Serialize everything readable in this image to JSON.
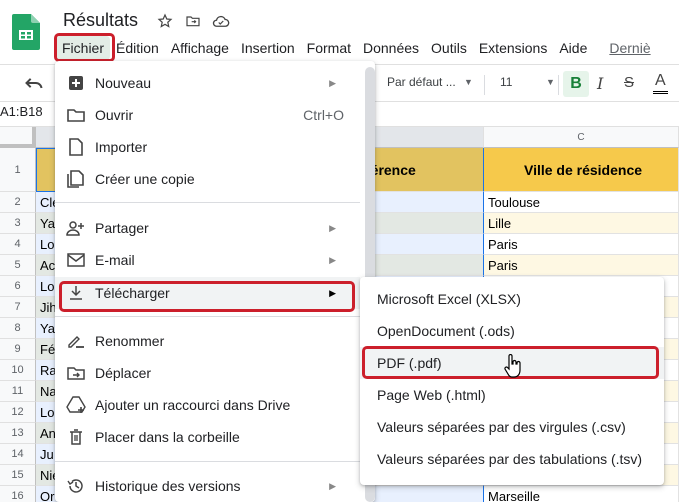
{
  "app": {
    "title": "Résultats",
    "logo_icon": "google-sheets-logo",
    "title_icons": [
      "star-icon",
      "move-to-folder-icon",
      "cloud-saved-icon"
    ]
  },
  "menubar": {
    "items": [
      "Fichier",
      "Édition",
      "Affichage",
      "Insertion",
      "Format",
      "Données",
      "Outils",
      "Extensions",
      "Aide"
    ],
    "active": "Fichier",
    "last_edit": "Derniè"
  },
  "toolbar": {
    "undo_icon": "undo-icon",
    "font": "Par défaut ...",
    "font_size": "11",
    "bold": "B",
    "italic": "I",
    "strike": "S",
    "text_color": "A"
  },
  "name_box": "A1:B18",
  "grid": {
    "columns": [
      {
        "letter": "",
        "selected": true
      },
      {
        "letter": "",
        "selected": true
      },
      {
        "letter": "C",
        "selected": false
      }
    ],
    "header_row": {
      "b_partial": "férence",
      "c": "Ville de résidence"
    },
    "row_numbers": [
      "1",
      "2",
      "3",
      "4",
      "5",
      "6",
      "7",
      "8",
      "9",
      "10",
      "11",
      "12",
      "13",
      "14",
      "15",
      "16"
    ],
    "col_a_partial": [
      "",
      "Cle",
      "Ya",
      "Lo",
      "Ac",
      "Lo",
      "Jih",
      "Ya",
      "Fé",
      "Ra",
      "Na",
      "Lo",
      "An",
      "Ju",
      "Nie",
      "Or"
    ],
    "col_c": [
      "Toulouse",
      "Lille",
      "Paris",
      "Paris",
      "",
      "",
      "",
      "",
      "",
      "",
      "",
      "",
      "",
      "",
      "Marseille"
    ]
  },
  "file_menu": {
    "items": [
      {
        "label": "Nouveau",
        "icon": "new-icon",
        "submenu": true
      },
      {
        "label": "Ouvrir",
        "icon": "folder-icon",
        "shortcut": "Ctrl+O"
      },
      {
        "label": "Importer",
        "icon": "file-icon"
      },
      {
        "label": "Créer une copie",
        "icon": "copy-icon"
      },
      {
        "label": "Partager",
        "icon": "share-person-icon",
        "submenu": true
      },
      {
        "label": "E-mail",
        "icon": "mail-icon",
        "submenu": true
      },
      {
        "label": "Télécharger",
        "icon": "download-icon",
        "submenu": true,
        "highlighted": true
      },
      {
        "label": "Renommer",
        "icon": "rename-icon"
      },
      {
        "label": "Déplacer",
        "icon": "move-icon"
      },
      {
        "label": "Ajouter un raccourci dans Drive",
        "icon": "drive-shortcut-icon"
      },
      {
        "label": "Placer dans la corbeille",
        "icon": "trash-icon"
      },
      {
        "label": "Historique des versions",
        "icon": "history-icon",
        "submenu": true
      }
    ]
  },
  "download_submenu": {
    "items": [
      "Microsoft Excel (XLSX)",
      "OpenDocument (.ods)",
      "PDF (.pdf)",
      "Page Web (.html)",
      "Valeurs séparées par des virgules (.csv)",
      "Valeurs séparées par des tabulations (.tsv)"
    ],
    "hovered": "PDF (.pdf)"
  },
  "colors": {
    "highlight_red": "#cc1f2b",
    "sheets_green": "#188038",
    "header_yellow": "#f6c94b",
    "header_yellow_selected": "#e2c360",
    "row_alt_cream": "#fef8e3",
    "selection_blue": "#e8f0fe",
    "selection_alt": "#e3e8e3"
  }
}
